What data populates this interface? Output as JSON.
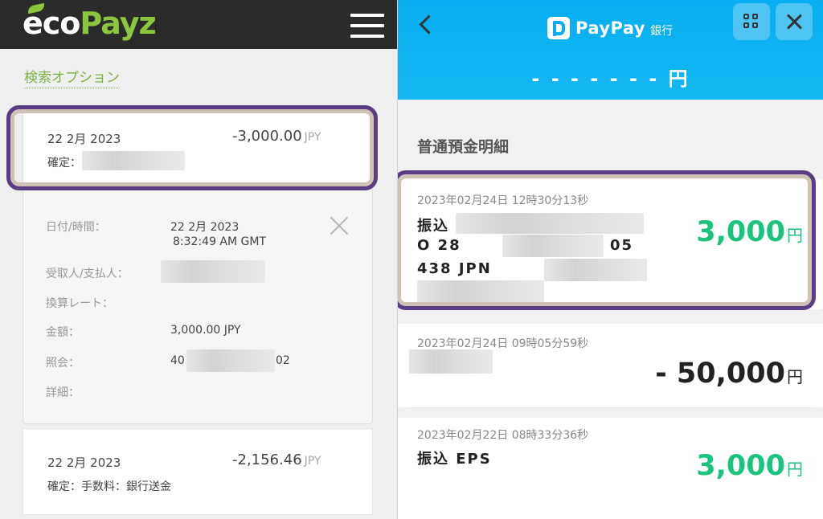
{
  "ecopayz": {
    "logo": {
      "eco": "eco",
      "payz": "Payz"
    },
    "search_option": "検索オプション",
    "transactions": [
      {
        "date": "22 2月 2023",
        "amount": "-3,000.00",
        "currency": "JPY",
        "status": "確定："
      },
      {
        "date": "22 2月 2023",
        "amount": "-2,156.46",
        "currency": "JPY",
        "status": "確定：手数料：銀行送金"
      }
    ],
    "details": {
      "datetime_label": "日付/時間：",
      "datetime_value_1": "22 2月 2023",
      "datetime_value_2": "8:32:49 AM GMT",
      "payee_label": "受取人/支払人：",
      "rate_label": "換算レート：",
      "amount_label": "金額：",
      "amount_value": "3,000.00 JPY",
      "ref_label": "照会：",
      "ref_prefix": "40",
      "ref_suffix": "02",
      "detail_label": "詳細："
    }
  },
  "paypay": {
    "brand": "PayPay",
    "brand_sub": "銀行",
    "balance": "- - - - - - - 円",
    "section_title": "普通預金明細",
    "entries": [
      {
        "timestamp": "2023年02月24日 12時30分13秒",
        "line1": "振込",
        "line2_a": "O 28",
        "line2_b": "05",
        "line3": "438 JPN",
        "amount": "3,000",
        "unit": "円",
        "type": "in"
      },
      {
        "timestamp": "2023年02月24日 09時05分59秒",
        "amount": "- 50,000",
        "unit": "円",
        "type": "out"
      },
      {
        "timestamp": "2023年02月22日 08時33分36秒",
        "line1": "振込 EPS",
        "amount": "3,000",
        "unit": "円",
        "type": "in"
      }
    ],
    "colors": {
      "header": "#09aef0",
      "income": "#1bc47d",
      "highlight": "#5a3d85"
    }
  }
}
